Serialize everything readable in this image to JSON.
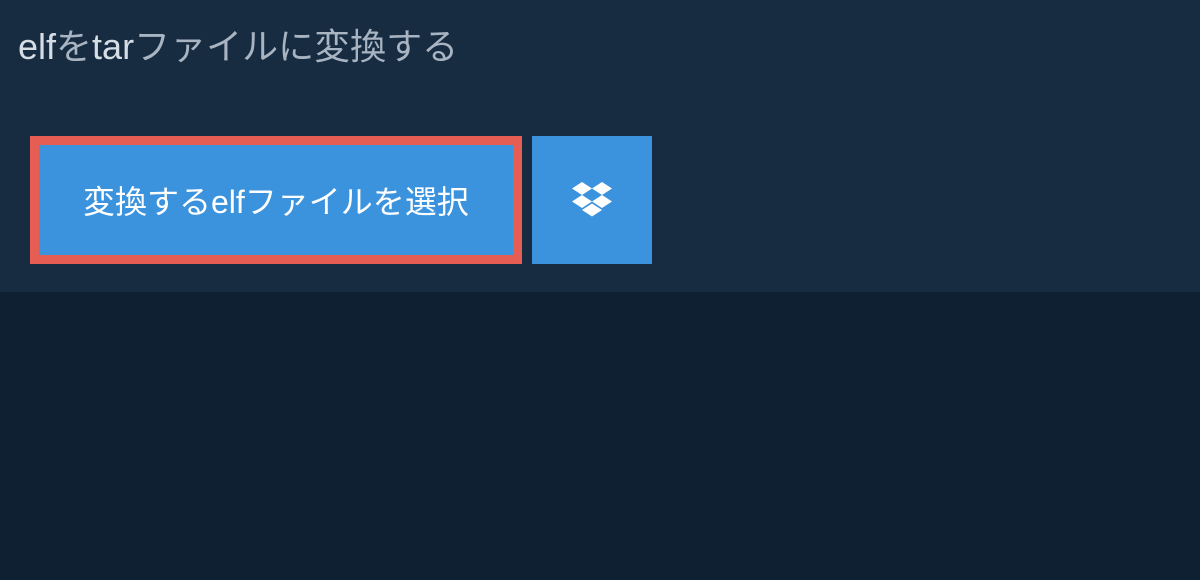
{
  "title": {
    "part1_light": "elf",
    "part2_dim": "を",
    "part3_light": "tar",
    "part4_dim": "ファイルに変換する"
  },
  "buttons": {
    "select_file_label": "変換するelfファイルを選択"
  }
}
